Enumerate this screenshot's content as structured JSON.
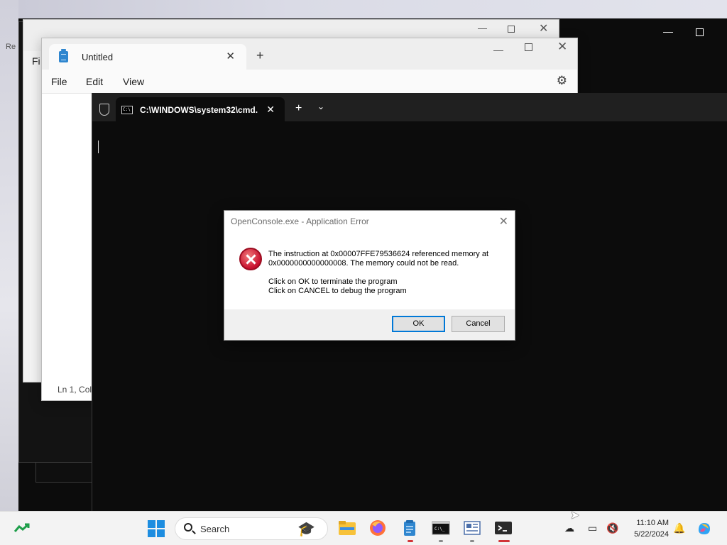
{
  "desktop": {
    "glyph": "Re"
  },
  "notepad_back": {
    "tab_title": "Untitled",
    "menu_file": "Fi"
  },
  "notepad": {
    "tab_title": "Untitled",
    "menu": [
      "File",
      "Edit",
      "View"
    ],
    "status_text": "Ln 1, Col"
  },
  "terminal": {
    "tab_title": "C:\\WINDOWS\\system32\\cmd."
  },
  "dialog": {
    "title": "OpenConsole.exe - Application Error",
    "message_line1": "The instruction at 0x00007FFE79536624 referenced memory at",
    "message_line2": "0x0000000000000008. The memory could not be read.",
    "message_line3": "Click on OK to terminate the program",
    "message_line4": "Click on CANCEL to debug the program",
    "ok_label": "OK",
    "cancel_label": "Cancel"
  },
  "taskbar": {
    "search_placeholder": "Search",
    "apps": [
      "file-explorer",
      "firefox",
      "notepad",
      "command-prompt",
      "news",
      "terminal"
    ],
    "time": "11:10 AM",
    "date": "5/22/2024"
  },
  "colors": {
    "accent": "#0078d7",
    "error_red": "#c8102e",
    "terminal_bg": "#0c0c0c",
    "taskbar_bg": "#f3f3f3"
  }
}
